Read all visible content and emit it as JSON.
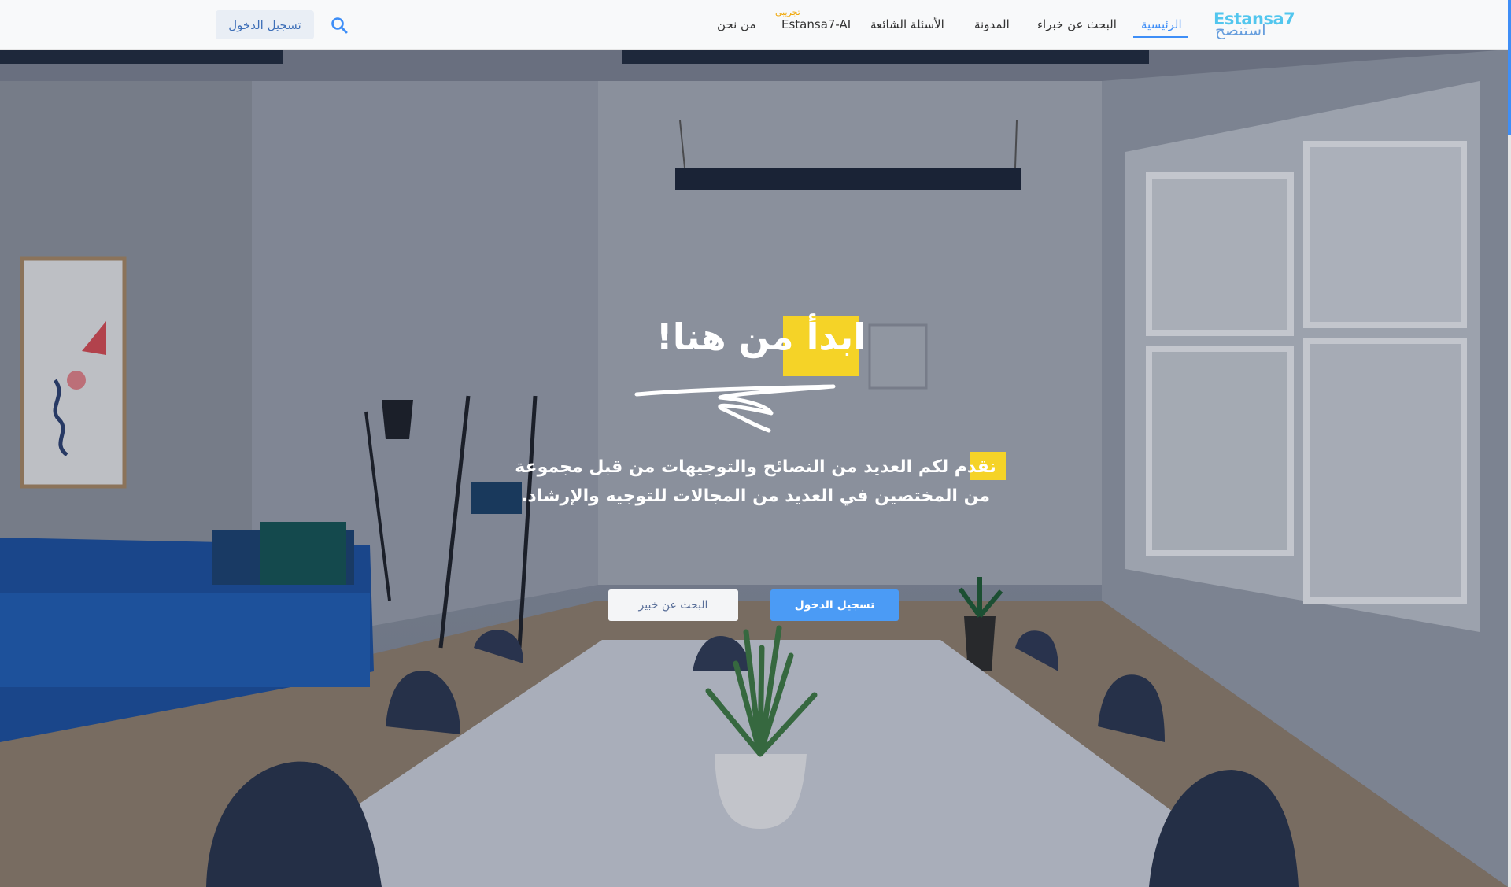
{
  "brand": {
    "logo_latin": "Estansa7",
    "logo_arabic": "استنصح"
  },
  "nav": {
    "items": [
      {
        "label": "الرئيسية",
        "active": true
      },
      {
        "label": "البحث عن خبراء"
      },
      {
        "label": "المدونة"
      },
      {
        "label": "الأسئلة الشائعة"
      },
      {
        "label": "Estansa7-AI",
        "badge": "تجريبي"
      },
      {
        "label": "من نحن"
      }
    ],
    "login_label": "تسجيل الدخول",
    "search_icon": "search-icon"
  },
  "hero": {
    "title": "ابدأ من هنا!",
    "subtitle": "نقدم لكم العديد من النصائح والتوجيهات من قبل مجموعة من المختصين في العديد من المجالات للتوجيه والإرشاد.",
    "primary_button": "تسجيل الدخول",
    "secondary_button": "البحث عن خبير"
  },
  "colors": {
    "accent": "#3e8ef7",
    "highlight": "#f5d327",
    "logo_latin": "#52c6ee"
  }
}
